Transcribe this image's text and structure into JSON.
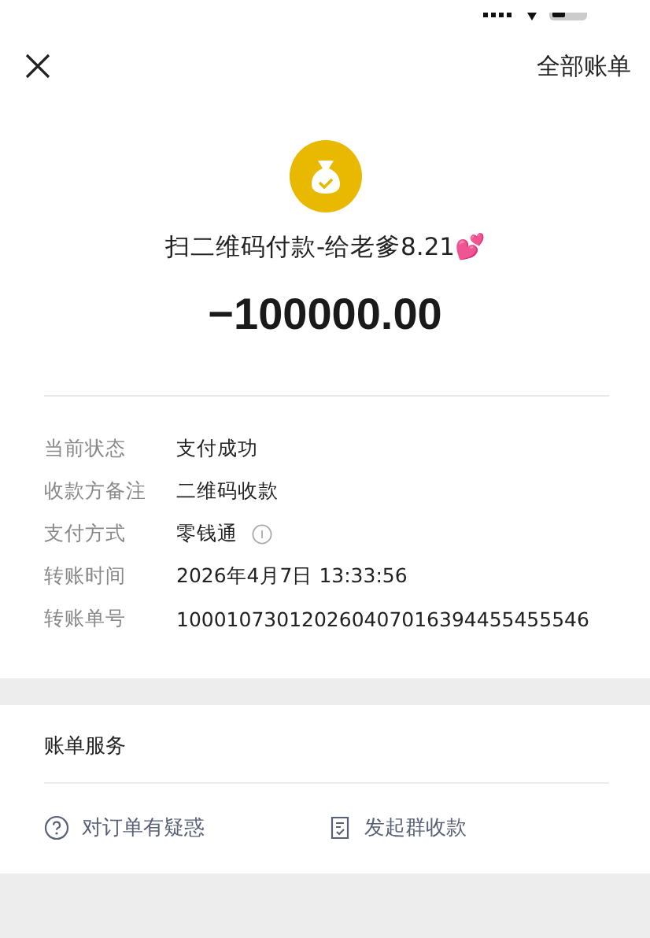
{
  "header": {
    "link": "全部账单"
  },
  "payment": {
    "title": "扫二维码付款-给老爹8.21💕",
    "amount": "−100000.00"
  },
  "details": [
    {
      "label": "当前状态",
      "value": "支付成功",
      "info": false
    },
    {
      "label": "收款方备注",
      "value": "二维码收款",
      "info": false
    },
    {
      "label": "支付方式",
      "value": "零钱通",
      "info": true
    },
    {
      "label": "转账时间",
      "value": "2026年4月7日 13:33:56",
      "info": false
    },
    {
      "label": "转账单号",
      "value": "100010730120260407016394455455546",
      "info": false
    }
  ],
  "services": {
    "title": "账单服务",
    "actions": [
      {
        "kind": "question",
        "label": "对订单有疑惑"
      },
      {
        "kind": "receipt",
        "label": "发起群收款"
      }
    ]
  }
}
